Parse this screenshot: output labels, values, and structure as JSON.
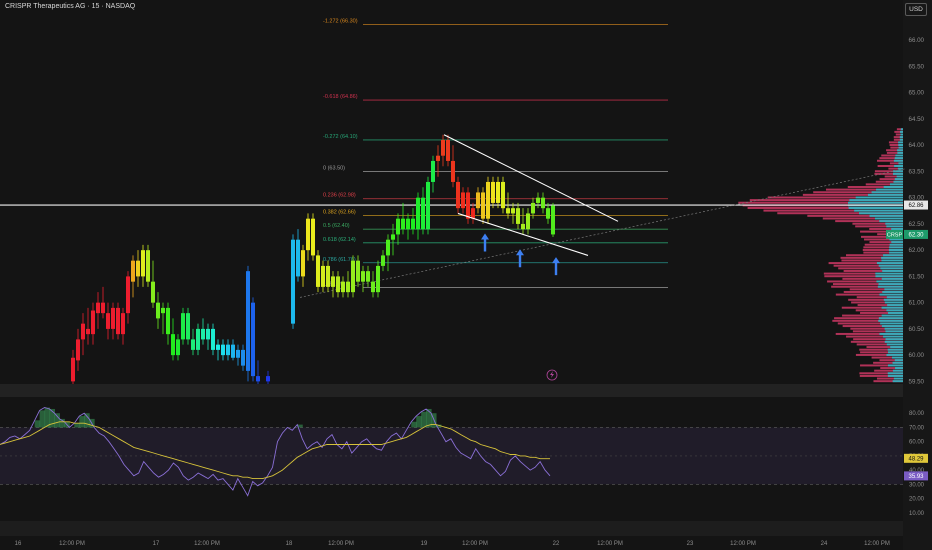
{
  "header": {
    "title": "CRISPR Therapeutics AG · 15 · NASDAQ",
    "currency": "USD"
  },
  "chart_data": {
    "type": "candlestick",
    "main": {
      "ylim": [
        59.45,
        66.5
      ],
      "yticks": [
        59.5,
        60.0,
        60.5,
        61.0,
        61.5,
        62.0,
        62.5,
        63.0,
        63.5,
        64.0,
        64.5,
        65.0,
        65.5,
        66.0
      ],
      "price_labels": [
        {
          "value": 62.86,
          "text": "62.86",
          "kind": "line"
        },
        {
          "value": 62.3,
          "text": "62.30",
          "kind": "last",
          "symbol": "CRSP"
        }
      ],
      "candles": [
        {
          "x": 73,
          "o": 59.5,
          "h": 60.1,
          "l": 59.45,
          "c": 59.95
        },
        {
          "x": 78,
          "o": 59.9,
          "h": 60.5,
          "l": 59.7,
          "c": 60.3
        },
        {
          "x": 83,
          "o": 60.3,
          "h": 60.8,
          "l": 60.0,
          "c": 60.6
        },
        {
          "x": 88,
          "o": 60.5,
          "h": 60.9,
          "l": 60.2,
          "c": 60.4
        },
        {
          "x": 93,
          "o": 60.4,
          "h": 61.0,
          "l": 60.2,
          "c": 60.85
        },
        {
          "x": 98,
          "o": 60.8,
          "h": 61.2,
          "l": 60.5,
          "c": 61.0
        },
        {
          "x": 103,
          "o": 61.0,
          "h": 61.3,
          "l": 60.7,
          "c": 60.8
        },
        {
          "x": 108,
          "o": 60.8,
          "h": 61.0,
          "l": 60.3,
          "c": 60.5
        },
        {
          "x": 113,
          "o": 60.5,
          "h": 61.0,
          "l": 60.3,
          "c": 60.9
        },
        {
          "x": 118,
          "o": 60.9,
          "h": 61.0,
          "l": 60.3,
          "c": 60.4
        },
        {
          "x": 123,
          "o": 60.4,
          "h": 60.9,
          "l": 60.2,
          "c": 60.8
        },
        {
          "x": 128,
          "o": 60.8,
          "h": 61.6,
          "l": 60.6,
          "c": 61.5
        },
        {
          "x": 133,
          "o": 61.4,
          "h": 61.9,
          "l": 61.1,
          "c": 61.8
        },
        {
          "x": 138,
          "o": 61.8,
          "h": 62.0,
          "l": 61.3,
          "c": 61.5
        },
        {
          "x": 143,
          "o": 61.5,
          "h": 62.1,
          "l": 61.3,
          "c": 62.0
        },
        {
          "x": 148,
          "o": 62.0,
          "h": 62.1,
          "l": 61.3,
          "c": 61.4
        },
        {
          "x": 153,
          "o": 61.4,
          "h": 61.8,
          "l": 60.9,
          "c": 61.0
        },
        {
          "x": 158,
          "o": 61.0,
          "h": 61.2,
          "l": 60.5,
          "c": 60.7
        },
        {
          "x": 163,
          "o": 60.8,
          "h": 61.0,
          "l": 60.4,
          "c": 60.9
        },
        {
          "x": 168,
          "o": 60.9,
          "h": 61.0,
          "l": 60.2,
          "c": 60.4
        },
        {
          "x": 173,
          "o": 60.4,
          "h": 60.7,
          "l": 59.9,
          "c": 60.0
        },
        {
          "x": 178,
          "o": 60.0,
          "h": 60.4,
          "l": 59.9,
          "c": 60.3
        },
        {
          "x": 183,
          "o": 60.3,
          "h": 60.9,
          "l": 60.2,
          "c": 60.8
        },
        {
          "x": 188,
          "o": 60.8,
          "h": 60.9,
          "l": 60.2,
          "c": 60.3
        },
        {
          "x": 193,
          "o": 60.3,
          "h": 60.5,
          "l": 60.0,
          "c": 60.1
        },
        {
          "x": 198,
          "o": 60.1,
          "h": 60.6,
          "l": 60.0,
          "c": 60.5
        },
        {
          "x": 203,
          "o": 60.5,
          "h": 60.7,
          "l": 60.2,
          "c": 60.3
        },
        {
          "x": 208,
          "o": 60.3,
          "h": 60.6,
          "l": 60.1,
          "c": 60.5
        },
        {
          "x": 213,
          "o": 60.5,
          "h": 60.6,
          "l": 60.0,
          "c": 60.1
        },
        {
          "x": 218,
          "o": 60.1,
          "h": 60.3,
          "l": 59.9,
          "c": 60.2
        },
        {
          "x": 223,
          "o": 60.2,
          "h": 60.3,
          "l": 59.9,
          "c": 60.0
        },
        {
          "x": 228,
          "o": 60.0,
          "h": 60.3,
          "l": 59.9,
          "c": 60.2
        },
        {
          "x": 233,
          "o": 60.2,
          "h": 60.3,
          "l": 59.9,
          "c": 59.95
        },
        {
          "x": 238,
          "o": 59.95,
          "h": 60.2,
          "l": 59.8,
          "c": 60.1
        },
        {
          "x": 243,
          "o": 60.1,
          "h": 60.2,
          "l": 59.7,
          "c": 59.8
        },
        {
          "x": 248,
          "o": 59.7,
          "h": 61.7,
          "l": 59.5,
          "c": 61.6
        },
        {
          "x": 253,
          "o": 61.0,
          "h": 61.1,
          "l": 59.5,
          "c": 59.6
        },
        {
          "x": 258,
          "o": 59.6,
          "h": 59.9,
          "l": 59.45,
          "c": 59.5
        },
        {
          "x": 268,
          "o": 59.6,
          "h": 59.7,
          "l": 59.45,
          "c": 59.5
        },
        {
          "x": 293,
          "o": 60.6,
          "h": 62.3,
          "l": 60.5,
          "c": 62.2
        },
        {
          "x": 298,
          "o": 62.2,
          "h": 62.4,
          "l": 61.4,
          "c": 61.5
        },
        {
          "x": 303,
          "o": 61.5,
          "h": 62.1,
          "l": 61.3,
          "c": 62.0
        },
        {
          "x": 308,
          "o": 62.0,
          "h": 62.7,
          "l": 61.8,
          "c": 62.6
        },
        {
          "x": 313,
          "o": 62.6,
          "h": 62.7,
          "l": 61.8,
          "c": 61.9
        },
        {
          "x": 318,
          "o": 61.9,
          "h": 62.0,
          "l": 61.2,
          "c": 61.3
        },
        {
          "x": 323,
          "o": 61.3,
          "h": 61.8,
          "l": 61.2,
          "c": 61.7
        },
        {
          "x": 328,
          "o": 61.7,
          "h": 61.8,
          "l": 61.2,
          "c": 61.3
        },
        {
          "x": 333,
          "o": 61.3,
          "h": 61.6,
          "l": 61.1,
          "c": 61.5
        },
        {
          "x": 338,
          "o": 61.5,
          "h": 61.6,
          "l": 61.1,
          "c": 61.2
        },
        {
          "x": 343,
          "o": 61.2,
          "h": 61.5,
          "l": 61.1,
          "c": 61.4
        },
        {
          "x": 348,
          "o": 61.4,
          "h": 61.6,
          "l": 61.1,
          "c": 61.2
        },
        {
          "x": 353,
          "o": 61.2,
          "h": 61.9,
          "l": 61.1,
          "c": 61.8
        },
        {
          "x": 358,
          "o": 61.8,
          "h": 61.9,
          "l": 61.3,
          "c": 61.4
        },
        {
          "x": 363,
          "o": 61.4,
          "h": 61.7,
          "l": 61.2,
          "c": 61.6
        },
        {
          "x": 368,
          "o": 61.6,
          "h": 61.7,
          "l": 61.3,
          "c": 61.4
        },
        {
          "x": 373,
          "o": 61.4,
          "h": 61.6,
          "l": 61.1,
          "c": 61.2
        },
        {
          "x": 378,
          "o": 61.2,
          "h": 61.8,
          "l": 61.1,
          "c": 61.7
        },
        {
          "x": 383,
          "o": 61.7,
          "h": 62.0,
          "l": 61.6,
          "c": 61.9
        },
        {
          "x": 388,
          "o": 61.9,
          "h": 62.3,
          "l": 61.6,
          "c": 62.2
        },
        {
          "x": 393,
          "o": 62.2,
          "h": 62.5,
          "l": 61.9,
          "c": 62.3
        },
        {
          "x": 398,
          "o": 62.3,
          "h": 62.7,
          "l": 62.1,
          "c": 62.6
        },
        {
          "x": 403,
          "o": 62.6,
          "h": 62.9,
          "l": 62.3,
          "c": 62.4
        },
        {
          "x": 408,
          "o": 62.4,
          "h": 62.7,
          "l": 62.2,
          "c": 62.6
        },
        {
          "x": 413,
          "o": 62.6,
          "h": 62.8,
          "l": 62.3,
          "c": 62.4
        },
        {
          "x": 418,
          "o": 62.4,
          "h": 63.1,
          "l": 62.2,
          "c": 63.0
        },
        {
          "x": 423,
          "o": 63.0,
          "h": 63.2,
          "l": 62.3,
          "c": 62.4
        },
        {
          "x": 428,
          "o": 62.4,
          "h": 63.4,
          "l": 62.3,
          "c": 63.3
        },
        {
          "x": 433,
          "o": 63.3,
          "h": 63.8,
          "l": 63.1,
          "c": 63.7
        },
        {
          "x": 438,
          "o": 63.7,
          "h": 64.0,
          "l": 63.4,
          "c": 63.8
        },
        {
          "x": 443,
          "o": 63.8,
          "h": 64.2,
          "l": 63.6,
          "c": 64.1
        },
        {
          "x": 448,
          "o": 64.1,
          "h": 64.2,
          "l": 63.6,
          "c": 63.7
        },
        {
          "x": 453,
          "o": 63.7,
          "h": 64.0,
          "l": 63.2,
          "c": 63.3
        },
        {
          "x": 458,
          "o": 63.3,
          "h": 63.4,
          "l": 62.7,
          "c": 62.8
        },
        {
          "x": 463,
          "o": 62.8,
          "h": 63.2,
          "l": 62.7,
          "c": 63.1
        },
        {
          "x": 468,
          "o": 63.1,
          "h": 63.2,
          "l": 62.5,
          "c": 62.6
        },
        {
          "x": 473,
          "o": 62.6,
          "h": 62.9,
          "l": 62.5,
          "c": 62.8
        },
        {
          "x": 478,
          "o": 62.8,
          "h": 63.2,
          "l": 62.7,
          "c": 63.1
        },
        {
          "x": 483,
          "o": 63.1,
          "h": 63.2,
          "l": 62.5,
          "c": 62.6
        },
        {
          "x": 488,
          "o": 62.6,
          "h": 63.4,
          "l": 62.5,
          "c": 63.3
        },
        {
          "x": 493,
          "o": 63.3,
          "h": 63.4,
          "l": 62.8,
          "c": 62.9
        },
        {
          "x": 498,
          "o": 62.9,
          "h": 63.4,
          "l": 62.8,
          "c": 63.3
        },
        {
          "x": 503,
          "o": 63.3,
          "h": 63.4,
          "l": 62.7,
          "c": 62.8
        },
        {
          "x": 508,
          "o": 62.8,
          "h": 63.1,
          "l": 62.6,
          "c": 62.7
        },
        {
          "x": 513,
          "o": 62.7,
          "h": 62.9,
          "l": 62.5,
          "c": 62.8
        },
        {
          "x": 518,
          "o": 62.8,
          "h": 62.9,
          "l": 62.4,
          "c": 62.5
        },
        {
          "x": 523,
          "o": 62.5,
          "h": 62.8,
          "l": 62.3,
          "c": 62.4
        },
        {
          "x": 528,
          "o": 62.4,
          "h": 62.8,
          "l": 62.3,
          "c": 62.7
        },
        {
          "x": 533,
          "o": 62.7,
          "h": 63.0,
          "l": 62.6,
          "c": 62.9
        },
        {
          "x": 538,
          "o": 62.9,
          "h": 63.1,
          "l": 62.8,
          "c": 63.0
        },
        {
          "x": 543,
          "o": 63.0,
          "h": 63.1,
          "l": 62.7,
          "c": 62.8
        },
        {
          "x": 548,
          "o": 62.8,
          "h": 62.9,
          "l": 62.5,
          "c": 62.6
        },
        {
          "x": 553,
          "o": 62.85,
          "h": 62.9,
          "l": 62.25,
          "c": 62.3
        }
      ],
      "fib_levels": [
        {
          "label": "-1.272 (66.30)",
          "value": 66.3,
          "color": "#d9881e"
        },
        {
          "label": "-0.618 (64.86)",
          "value": 64.86,
          "color": "#d0324f"
        },
        {
          "label": "-0.272 (64.10)",
          "value": 64.1,
          "color": "#27a878"
        },
        {
          "label": "0 (63.50)",
          "value": 63.5,
          "color": "#9a9a9a"
        },
        {
          "label": "0.236 (62.98)",
          "value": 62.98,
          "color": "#e0404a"
        },
        {
          "label": "0.382 (62.66)",
          "value": 62.66,
          "color": "#d9a11e"
        },
        {
          "label": "0.5 (62.40)",
          "value": 62.4,
          "color": "#3aa860"
        },
        {
          "label": "0.618 (62.14)",
          "value": 62.14,
          "color": "#2bb07a"
        },
        {
          "label": "0.786 (61.76)",
          "value": 61.76,
          "color": "#2aa8a0"
        },
        {
          "label": "1 (61.29)",
          "value": 61.29,
          "color": "#9a9a9a"
        }
      ],
      "horizontal_line": 62.86
    },
    "rsi": {
      "ylim": [
        0,
        90
      ],
      "yticks": [
        10,
        20,
        30,
        40,
        50,
        60,
        70,
        80
      ],
      "bands": [
        30,
        70
      ],
      "labels": [
        {
          "value": 48.29,
          "text": "48.29"
        },
        {
          "value": 35.93,
          "text": "35.93"
        }
      ],
      "rsi_values": [
        58,
        60,
        63,
        64,
        62,
        65,
        68,
        75,
        82,
        84,
        83,
        80,
        76,
        74,
        70,
        73,
        78,
        80,
        76,
        70,
        66,
        64,
        60,
        55,
        50,
        44,
        40,
        36,
        38,
        46,
        42,
        38,
        35,
        37,
        40,
        45,
        42,
        36,
        33,
        35,
        38,
        36,
        34,
        37,
        33,
        34,
        30,
        26,
        34,
        28,
        22,
        32,
        29,
        31,
        36,
        42,
        60,
        66,
        70,
        68,
        72,
        62,
        55,
        58,
        60,
        56,
        62,
        65,
        58,
        55,
        60,
        52,
        56,
        60,
        62,
        58,
        55,
        54,
        60,
        64,
        66,
        62,
        68,
        74,
        78,
        81,
        83,
        80,
        72,
        66,
        60,
        62,
        56,
        52,
        50,
        48,
        55,
        50,
        46,
        44,
        40,
        36,
        39,
        47,
        50,
        46,
        43,
        40,
        42,
        46,
        40,
        36
      ],
      "ma_values": [
        58,
        59,
        60,
        61,
        62,
        63,
        64,
        66,
        68,
        70,
        72,
        73,
        74,
        74,
        74,
        73,
        73,
        73,
        72,
        71,
        70,
        68,
        66,
        64,
        62,
        60,
        58,
        56,
        55,
        54,
        53,
        52,
        51,
        50,
        49,
        48,
        47,
        46,
        45,
        44,
        43,
        42,
        41,
        40,
        39,
        38,
        37,
        36,
        36,
        35,
        35,
        34,
        34,
        34,
        35,
        36,
        38,
        40,
        43,
        46,
        49,
        51,
        53,
        55,
        56,
        57,
        58,
        58,
        58,
        58,
        58,
        58,
        58,
        58,
        58,
        58,
        58,
        58,
        59,
        60,
        61,
        62,
        63,
        65,
        67,
        69,
        71,
        72,
        72,
        71,
        70,
        69,
        67,
        65,
        63,
        61,
        60,
        58,
        57,
        56,
        55,
        53,
        52,
        51,
        51,
        50,
        50,
        49,
        49,
        48,
        48,
        48
      ]
    },
    "x_axis": {
      "ticks": [
        {
          "x": 18,
          "label": "16"
        },
        {
          "x": 72,
          "label": "12:00 PM"
        },
        {
          "x": 156,
          "label": "17"
        },
        {
          "x": 207,
          "label": "12:00 PM"
        },
        {
          "x": 289,
          "label": "18"
        },
        {
          "x": 341,
          "label": "12:00 PM"
        },
        {
          "x": 424,
          "label": "19"
        },
        {
          "x": 475,
          "label": "12:00 PM"
        },
        {
          "x": 556,
          "label": "22"
        },
        {
          "x": 610,
          "label": "12:00 PM"
        },
        {
          "x": 690,
          "label": "23"
        },
        {
          "x": 743,
          "label": "12:00 PM"
        },
        {
          "x": 824,
          "label": "24"
        },
        {
          "x": 877,
          "label": "12:00 PM"
        }
      ]
    }
  }
}
